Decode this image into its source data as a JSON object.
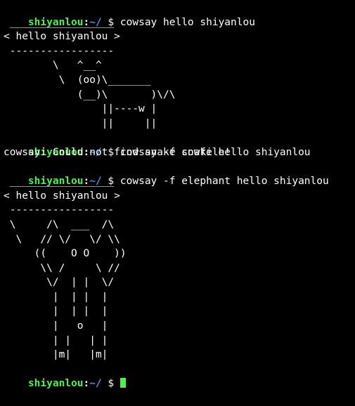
{
  "colors": {
    "background": "#000000",
    "user": "#4df04d",
    "path": "#4d8fe6",
    "text": "#ffffff",
    "cursor": "#4df04d"
  },
  "prompt": {
    "user": "shiyanlou",
    "separator": ":",
    "path": "~/",
    "symbol": " $ "
  },
  "commands": {
    "cmd1": "cowsay hello shiyanlou",
    "cmd2": "cowsay -f snake hello shiyanlou",
    "cmd3": "cowsay -f elephant hello shiyanlou",
    "cmd4": ""
  },
  "output1": [
    " _________________",
    "< hello shiyanlou >",
    " -----------------",
    "        \\   ^__^",
    "         \\  (oo)\\_______",
    "            (__)\\       )\\/\\",
    "                ||----w |",
    "                ||     ||"
  ],
  "output2": [
    "cowsay: Could not find snake cowfile!"
  ],
  "output3": [
    " _________________",
    "< hello shiyanlou >",
    " -----------------",
    " \\     /\\  ___  /\\",
    "  \\   // \\/   \\/ \\\\",
    "     ((    O O    ))",
    "      \\\\ /     \\ //",
    "       \\/  | |  \\/",
    "        |  | |  |",
    "        |  | |  |",
    "        |   o   |",
    "        | |   | |",
    "        |m|   |m|"
  ]
}
